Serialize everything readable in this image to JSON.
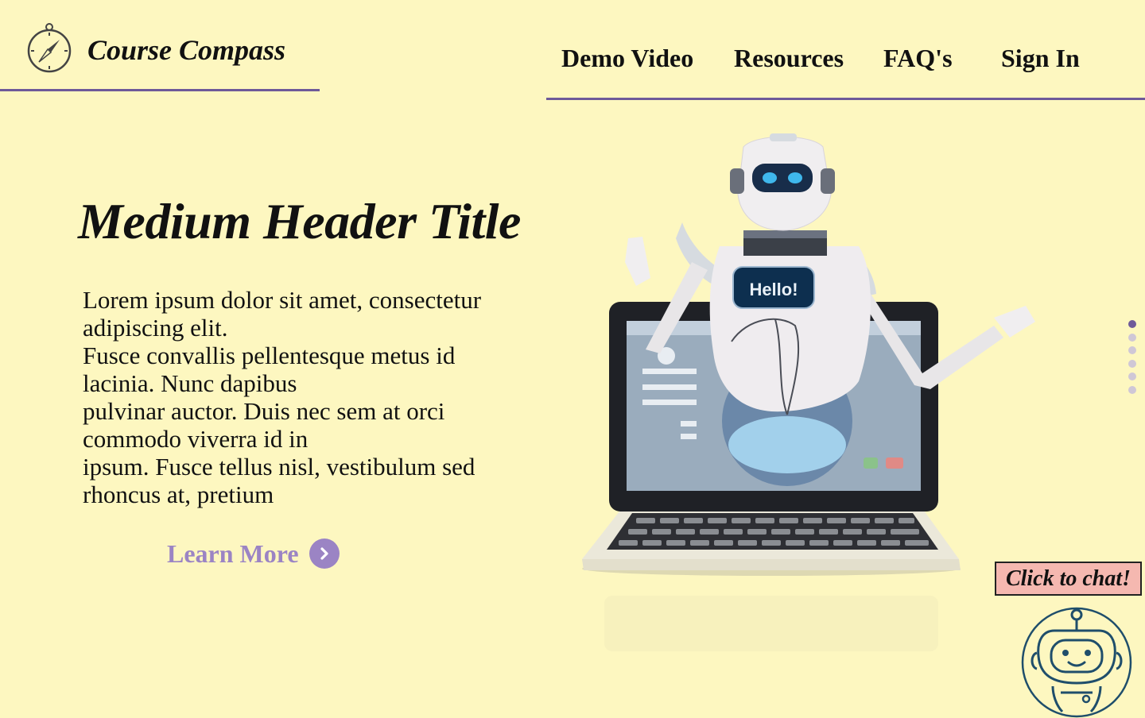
{
  "brand": {
    "name": "Course Compass",
    "icon": "compass-icon"
  },
  "nav": {
    "items": [
      {
        "label": "Demo Video"
      },
      {
        "label": "Resources"
      },
      {
        "label": "FAQ's"
      },
      {
        "label": "Sign In"
      }
    ]
  },
  "hero": {
    "title": "Medium Header Title",
    "body_lines": [
      "Lorem ipsum dolor sit amet, consectetur",
      "adipiscing elit.",
      "Fusce convallis pellentesque metus id",
      "lacinia. Nunc dapibus",
      "pulvinar auctor. Duis nec sem at orci",
      "commodo viverra id in",
      "ipsum. Fusce tellus nisl, vestibulum sed",
      "rhoncus at, pretium"
    ],
    "cta_label": "Learn More",
    "cta_icon": "chevron-right-icon",
    "illustration": {
      "screen_text": "Hello!"
    }
  },
  "pagination": {
    "count": 6,
    "active_index": 0
  },
  "chat": {
    "button_label": "Click to chat!",
    "icon": "robot-icon"
  },
  "colors": {
    "background": "#fdf7c0",
    "accent": "#6e5a99",
    "cta": "#9b84c4",
    "chat_button": "#f5b8b0",
    "robot_icon": "#1f4e6b"
  }
}
